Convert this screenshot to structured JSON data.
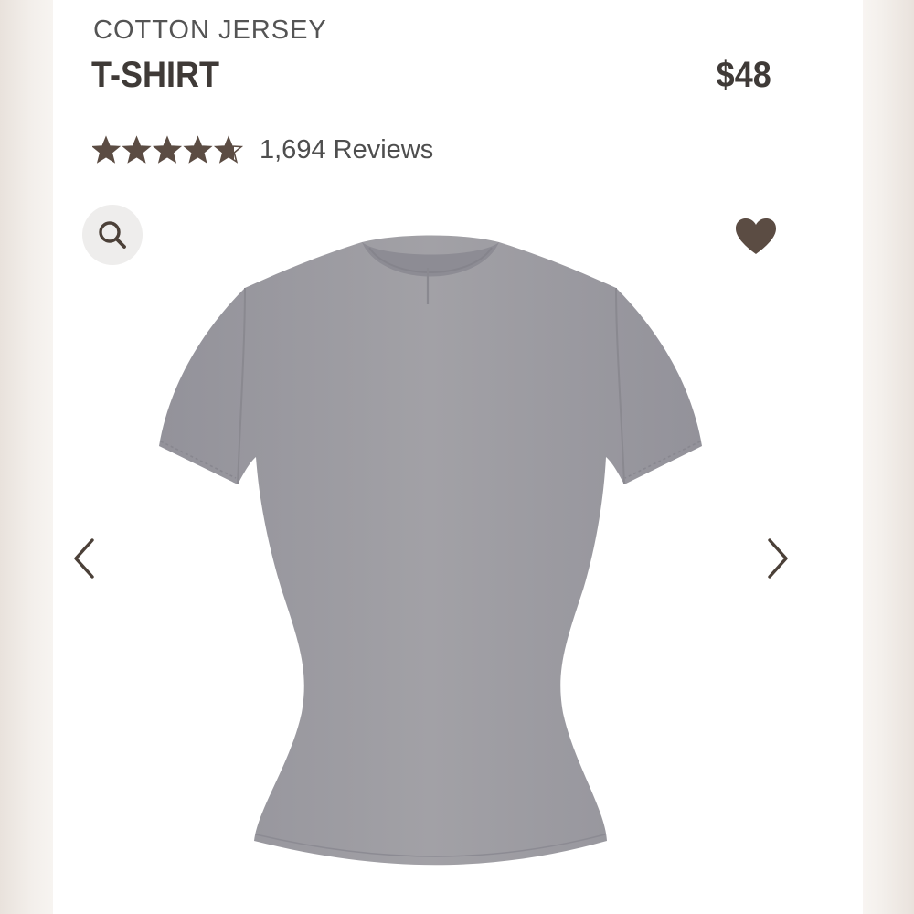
{
  "product": {
    "subtitle": "COTTON JERSEY",
    "title": "T-SHIRT",
    "price": "$48",
    "rating": 4.7,
    "rating_max": 5,
    "reviews_label": "1,694 Reviews"
  },
  "icons": {
    "zoom": "search-icon",
    "wishlist": "heart-icon",
    "previous": "chevron-left-icon",
    "next": "chevron-right-icon"
  },
  "colors": {
    "text_dark": "#3f3a37",
    "icon_brown": "#5b4c43",
    "shirt_gray": "#9c9ba0",
    "page_background": "#ffffff",
    "zoom_button_bg": "#eeedec"
  }
}
